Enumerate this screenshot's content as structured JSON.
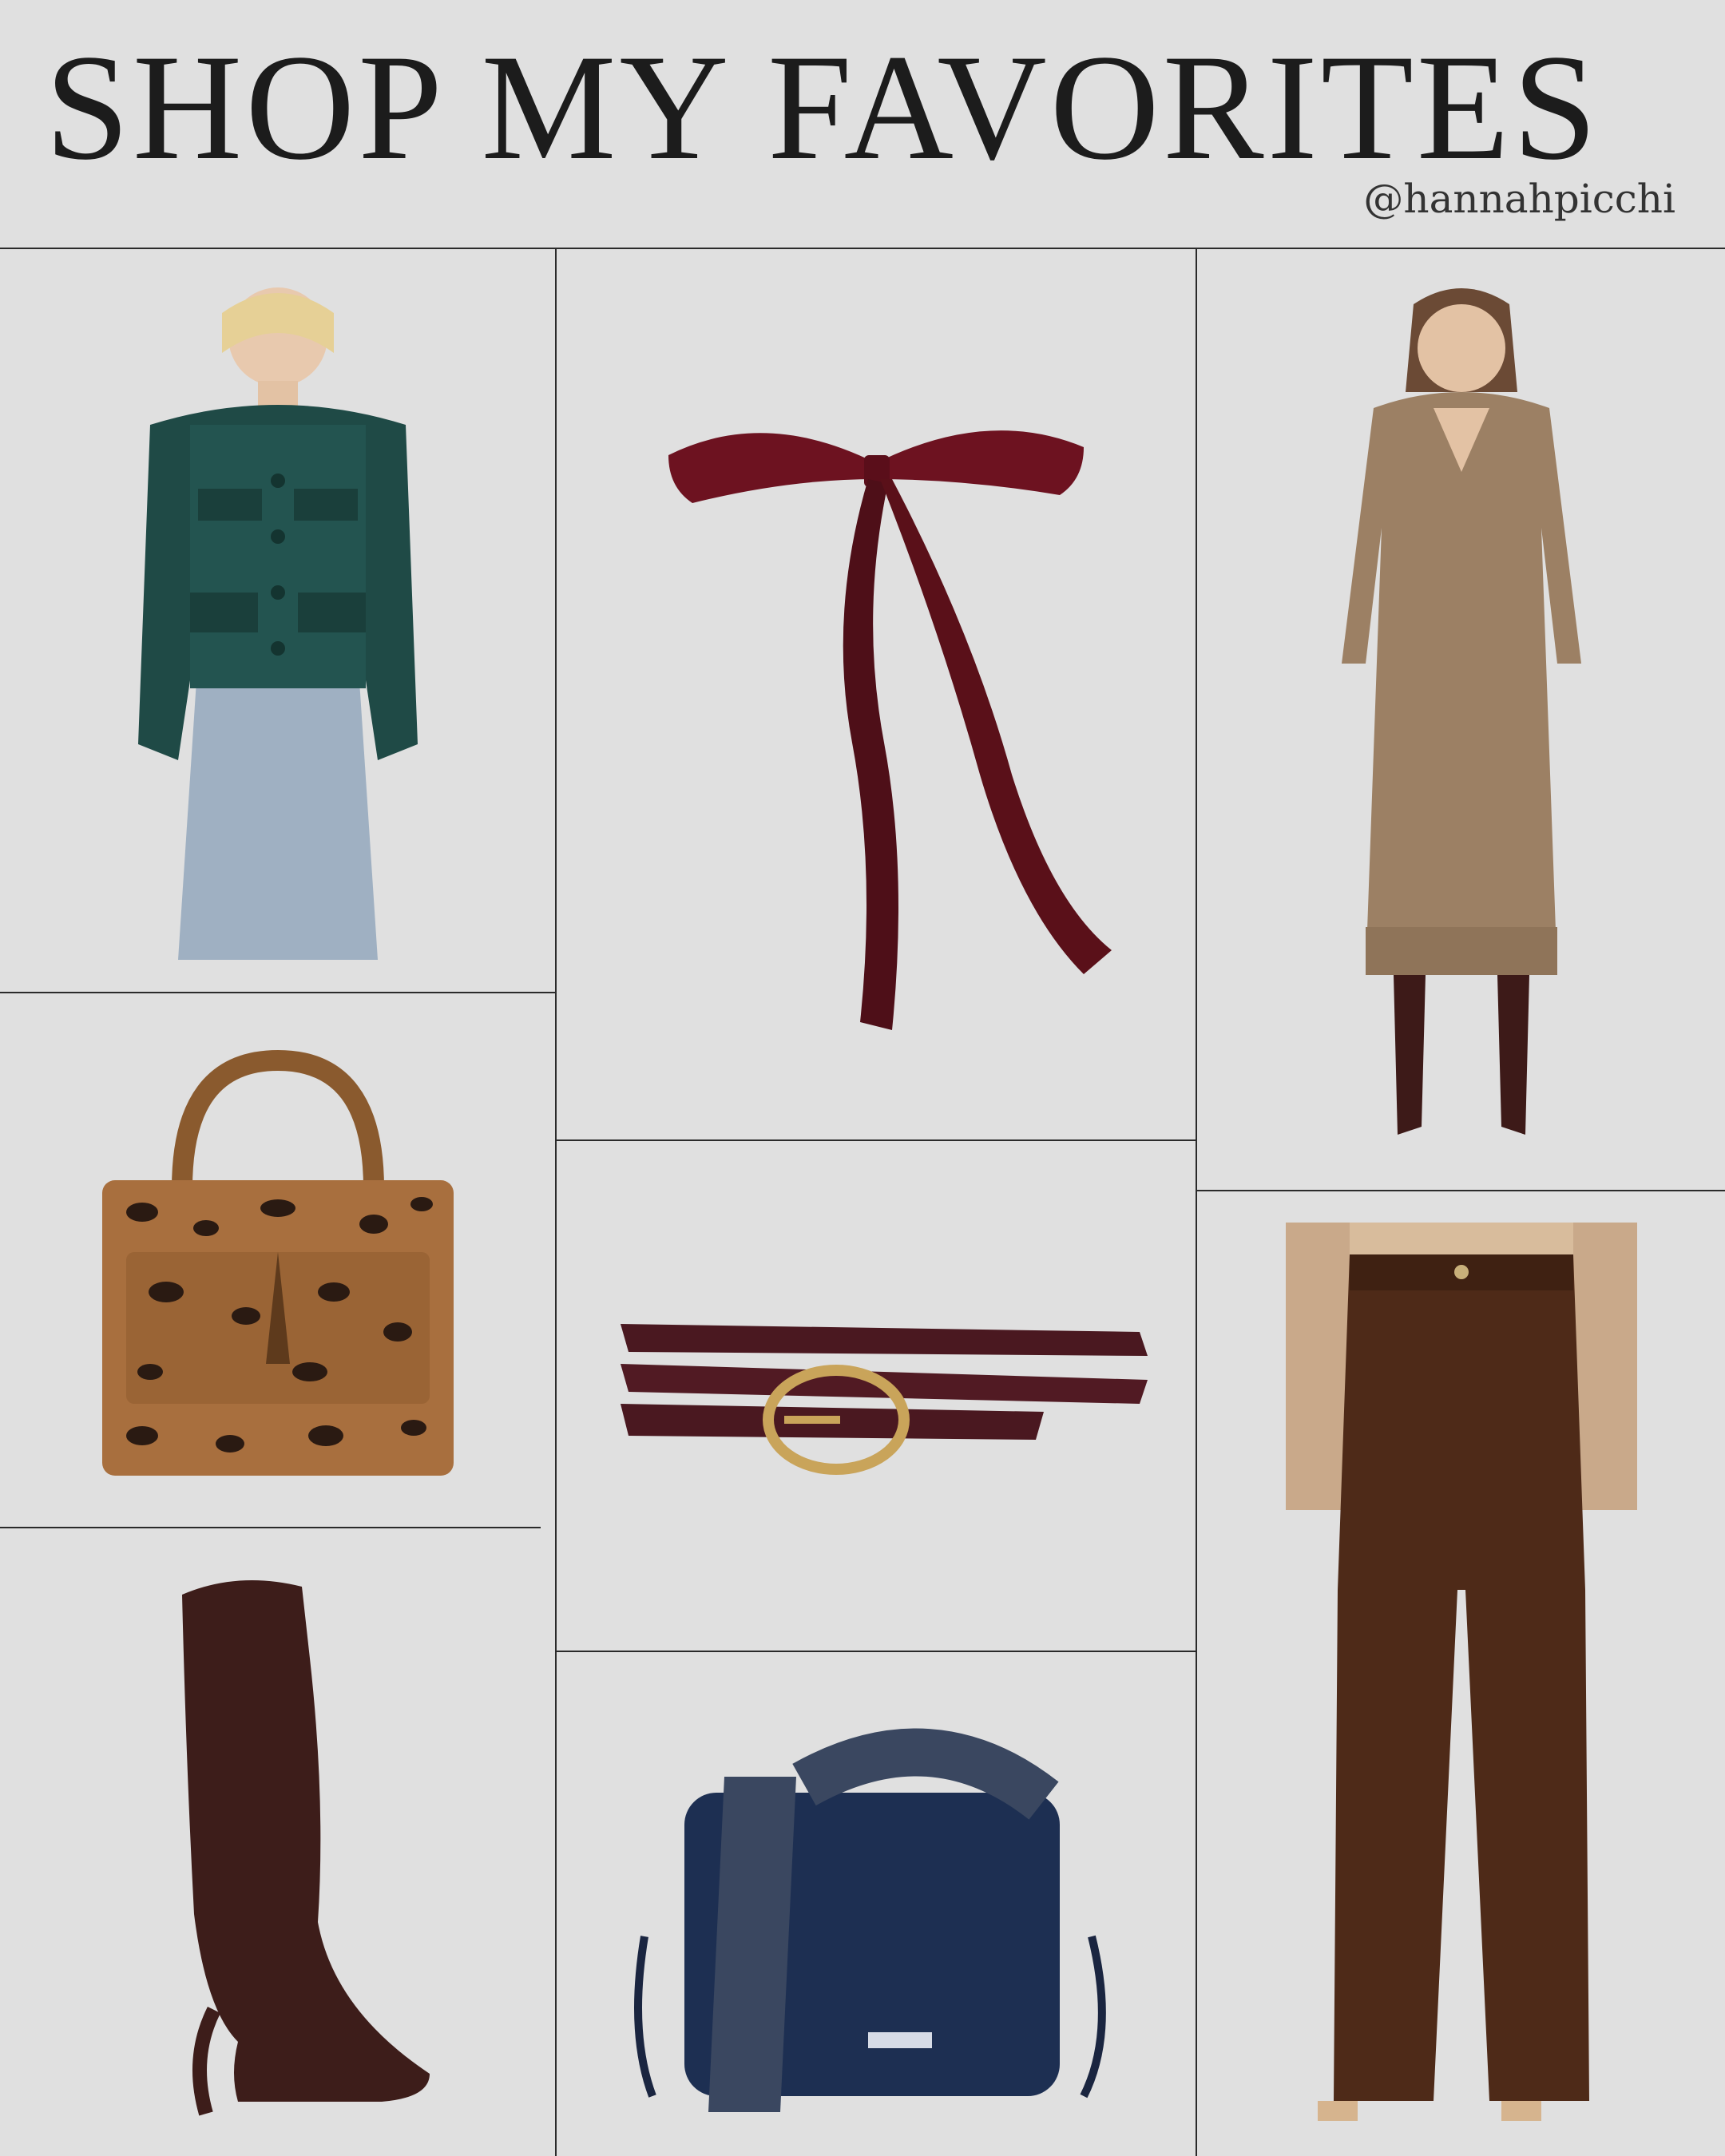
{
  "header": {
    "title": "SHOP MY FAVORITES",
    "handle": "@hannahpicchi"
  },
  "products": [
    {
      "name": "Green tweed cropped jacket",
      "color": "#1f4a46"
    },
    {
      "name": "Burgundy velvet hair bow",
      "color": "#6d1220"
    },
    {
      "name": "Camel knit sweater dress",
      "color": "#9c8064"
    },
    {
      "name": "Leopard print top handle bag",
      "color": "#8a5a2e"
    },
    {
      "name": "Burgundy croc-effect belt",
      "color": "#4a1820"
    },
    {
      "name": "Brown corduroy flare pants",
      "color": "#4e2a18"
    },
    {
      "name": "Brown suede knee-high boot",
      "color": "#3d1d1a"
    },
    {
      "name": "Navy crossbody camera bag",
      "color": "#1d2f52"
    }
  ],
  "colors": {
    "background": "#e0e0e0",
    "lines": "#2b2b2b"
  }
}
